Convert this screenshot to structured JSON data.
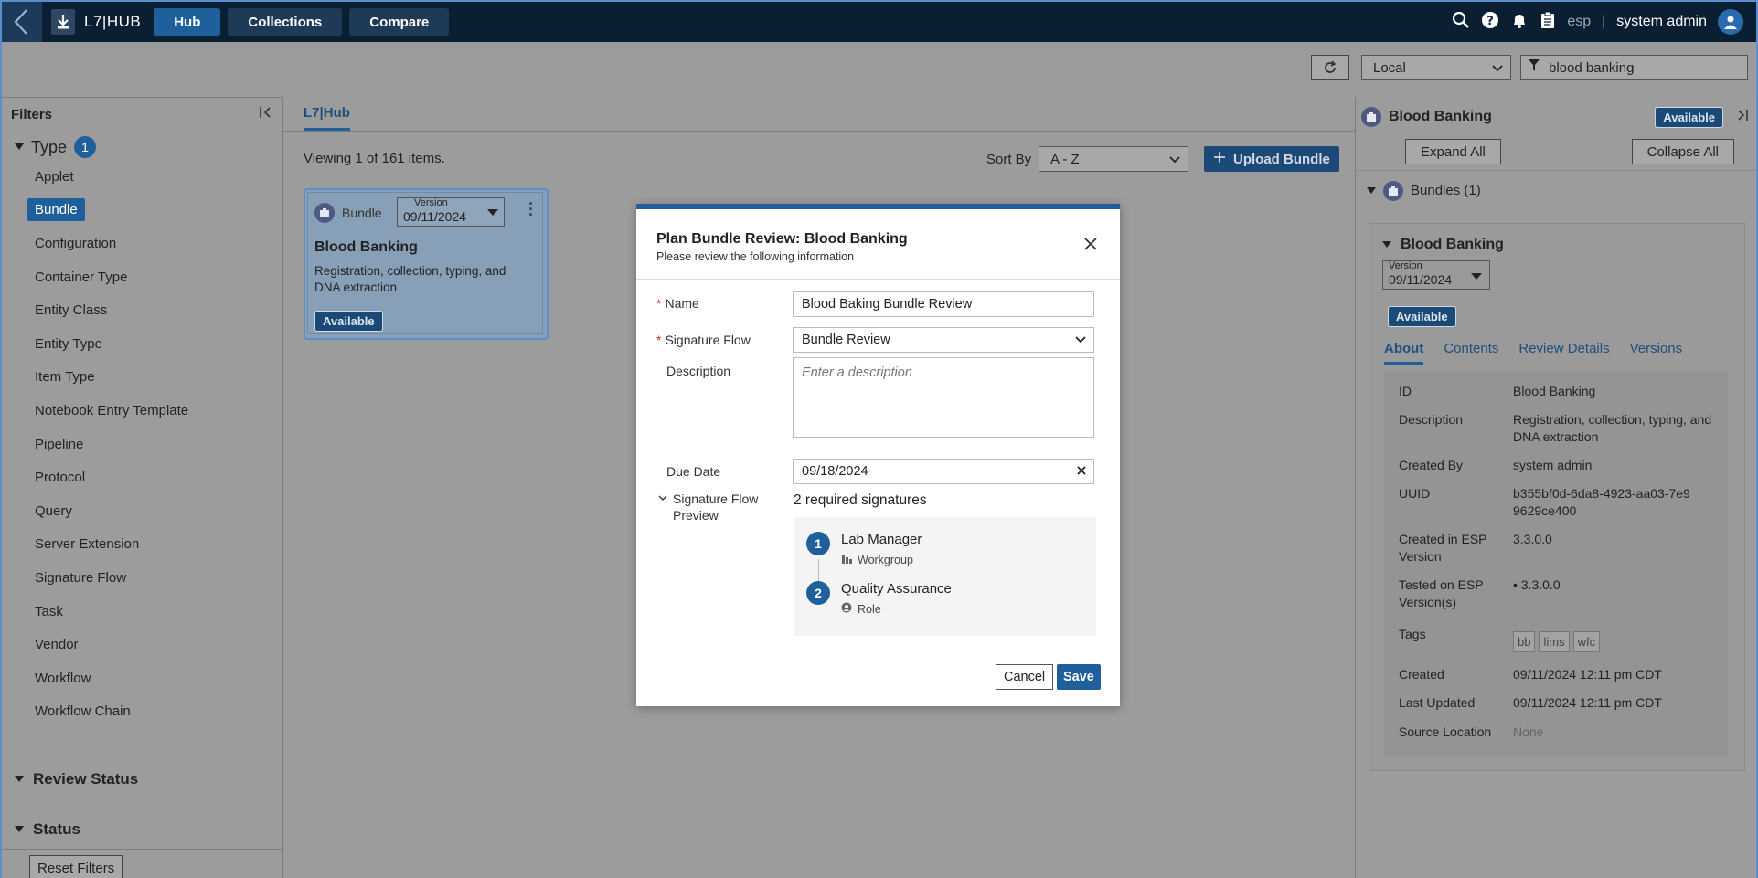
{
  "topbar": {
    "brand": "L7|HUB",
    "nav": [
      "Hub",
      "Collections",
      "Compare"
    ],
    "lang": "esp",
    "separator": "|",
    "user": "system admin"
  },
  "subbar": {
    "location": "Local",
    "search_value": "blood banking"
  },
  "filters": {
    "title": "Filters",
    "type_label": "Type",
    "type_count": "1",
    "types": [
      "Applet",
      "Bundle",
      "Configuration",
      "Container Type",
      "Entity Class",
      "Entity Type",
      "Item Type",
      "Notebook Entry Template",
      "Pipeline",
      "Protocol",
      "Query",
      "Server Extension",
      "Signature Flow",
      "Task",
      "Vendor",
      "Workflow",
      "Workflow Chain"
    ],
    "review_status": "Review Status",
    "status": "Status",
    "reset": "Reset Filters"
  },
  "main": {
    "tab": "L7|Hub",
    "viewing": "Viewing 1 of 161 items.",
    "sort_label": "Sort By",
    "sort_value": "A - Z",
    "upload": "Upload Bundle",
    "card": {
      "type": "Bundle",
      "version_label": "Version",
      "version": "09/11/2024",
      "title": "Blood Banking",
      "description": "Registration, collection, typing, and DNA extraction",
      "status": "Available"
    }
  },
  "right": {
    "title": "Blood Banking",
    "status": "Available",
    "expand": "Expand All",
    "collapse": "Collapse All",
    "bundles": "Bundles (1)",
    "bundle_title": "Blood Banking",
    "version_label": "Version",
    "version": "09/11/2024",
    "tabs": [
      "About",
      "Contents",
      "Review Details",
      "Versions"
    ],
    "about": {
      "id_k": "ID",
      "id_v": "Blood Banking",
      "desc_k": "Description",
      "desc_v": "Registration, collection, typing, and DNA extraction",
      "createdby_k": "Created By",
      "createdby_v": "system admin",
      "uuid_k": "UUID",
      "uuid_v": "b355bf0d-6da8-4923-aa03-7e99629ce400",
      "createdin_k": "Created in ESP Version",
      "createdin_v": "3.3.0.0",
      "tested_k": "Tested on ESP Version(s)",
      "tested_v": "3.3.0.0",
      "tags_k": "Tags",
      "tags": [
        "bb",
        "lims",
        "wfc"
      ],
      "created_k": "Created",
      "created_v": "09/11/2024 12:11 pm CDT",
      "updated_k": "Last Updated",
      "updated_v": "09/11/2024 12:11 pm CDT",
      "source_k": "Source Location",
      "source_v": "None"
    }
  },
  "modal": {
    "title": "Plan Bundle Review: Blood Banking",
    "subtitle": "Please review the following information",
    "name_label": "Name",
    "name_value": "Blood Baking Bundle Review",
    "sigflow_label": "Signature Flow",
    "sigflow_value": "Bundle Review",
    "desc_label": "Description",
    "desc_placeholder": "Enter a description",
    "due_label": "Due Date",
    "due_value": "09/18/2024",
    "preview_label": "Signature Flow Preview",
    "req_sigs": "2 required signatures",
    "steps": [
      {
        "num": "1",
        "name": "Lab Manager",
        "kind": "Workgroup"
      },
      {
        "num": "2",
        "name": "Quality Assurance",
        "kind": "Role"
      }
    ],
    "cancel": "Cancel",
    "save": "Save"
  }
}
